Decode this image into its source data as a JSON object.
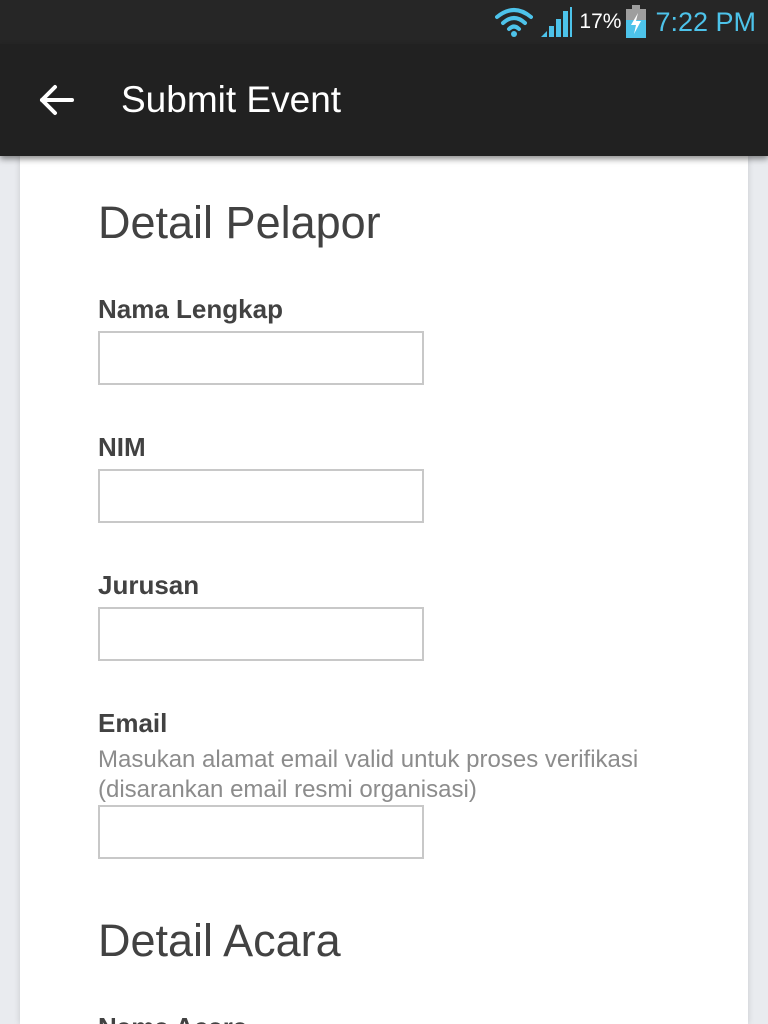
{
  "status_bar": {
    "wifi_icon": "wifi-icon",
    "signal_icon": "signal-icon",
    "battery_percent": "17%",
    "battery_icon": "battery-charging-icon",
    "time": "7:22 PM",
    "time_color": "#4dc3ea"
  },
  "app_bar": {
    "back_icon": "arrow-left-icon",
    "title": "Submit Event"
  },
  "form": {
    "reporter_section": {
      "title": "Detail Pelapor",
      "fields": {
        "full_name": {
          "label": "Nama Lengkap",
          "value": "",
          "placeholder": ""
        },
        "nim": {
          "label": "NIM",
          "value": "",
          "placeholder": ""
        },
        "major": {
          "label": "Jurusan",
          "value": "",
          "placeholder": ""
        },
        "email": {
          "label": "Email",
          "hint": "Masukan alamat email valid untuk proses verifikasi (disarankan email resmi organisasi)",
          "value": "",
          "placeholder": ""
        }
      }
    },
    "event_section": {
      "title": "Detail Acara",
      "first_field_label": "Nama Acara"
    }
  }
}
